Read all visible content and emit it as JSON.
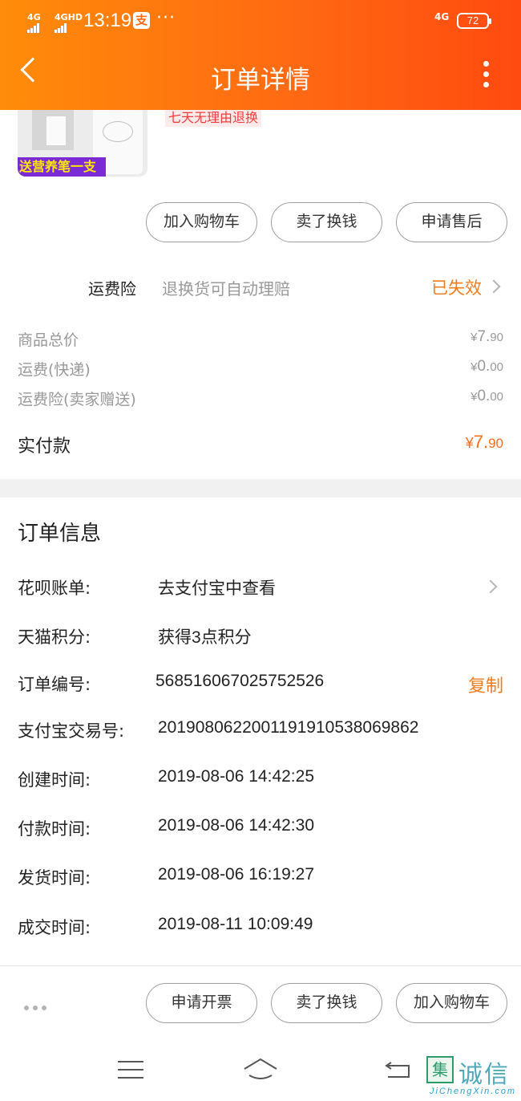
{
  "status_bar": {
    "signal1": "4G",
    "signal2": "4GHD",
    "time": "13:19",
    "app_badge": "支",
    "more": "···",
    "network": "4G",
    "battery": "72"
  },
  "nav": {
    "title": "订单详情"
  },
  "product": {
    "gift_tag": "送营养笔一支",
    "return_tag": "七天无理由退换"
  },
  "item_actions": {
    "add_cart": "加入购物车",
    "sell": "卖了换钱",
    "after_sale": "申请售后"
  },
  "insurance": {
    "title": "运费险",
    "desc": "退换货可自动理赔",
    "status": "已失效"
  },
  "price": {
    "goods_label": "商品总价",
    "goods_cur": "¥",
    "goods_int": "7.",
    "goods_dec": "90",
    "shipping_label": "运费(快递)",
    "shipping_cur": "¥",
    "shipping_int": "0.",
    "shipping_dec": "00",
    "insurance_label": "运费险(卖家赠送)",
    "insurance_cur": "¥",
    "insurance_int": "0.",
    "insurance_dec": "00",
    "total_label": "实付款",
    "total_cur": "¥",
    "total_int": "7.",
    "total_dec": "90"
  },
  "order_info": {
    "title": "订单信息",
    "rows": [
      {
        "label": "花呗账单:",
        "value": "去支付宝中查看"
      },
      {
        "label": "天猫积分:",
        "value": "获得3点积分"
      },
      {
        "label": "订单编号:",
        "value": "568516067025752526",
        "action": "复制"
      },
      {
        "label": "支付宝交易号:",
        "value": "2019080622001191910538069862"
      },
      {
        "label": "创建时间:",
        "value": "2019-08-06 14:42:25"
      },
      {
        "label": "付款时间:",
        "value": "2019-08-06 14:42:30"
      },
      {
        "label": "发货时间:",
        "value": "2019-08-06 16:19:27"
      },
      {
        "label": "成交时间:",
        "value": "2019-08-11 10:09:49"
      }
    ]
  },
  "bottom_actions": {
    "invoice": "申请开票",
    "sell": "卖了换钱",
    "add_cart": "加入购物车"
  },
  "watermark": {
    "logo": "集",
    "text": "诚信",
    "sub": "JiChengXin.com"
  },
  "colors": {
    "header_start": "#ff8c0a",
    "header_end": "#ff4a10",
    "accent_orange": "#f07c1e"
  }
}
